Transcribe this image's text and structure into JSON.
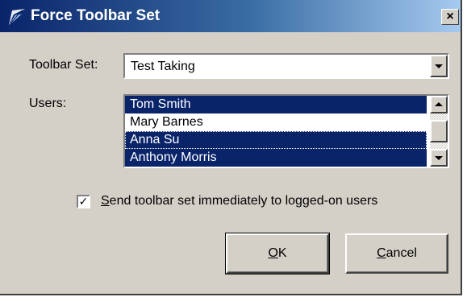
{
  "window": {
    "title": "Force Toolbar Set",
    "close_glyph": "×",
    "icon": "toolbar-app-icon"
  },
  "toolbar_set": {
    "label": "Toolbar Set:",
    "value": "Test Taking"
  },
  "users": {
    "label": "Users:",
    "items": [
      {
        "name": "Tom Smith",
        "selected": true
      },
      {
        "name": "Mary Barnes",
        "selected": false
      },
      {
        "name": "Anna Su",
        "selected": true,
        "focused": true
      },
      {
        "name": "Anthony Morris",
        "selected": true
      }
    ]
  },
  "send_option": {
    "checked": true,
    "check_mark": "✓",
    "mnemonic": "S",
    "label_rest": "end toolbar set immediately to logged-on users"
  },
  "buttons": {
    "ok": {
      "mnemonic": "O",
      "rest": "K"
    },
    "cancel": {
      "mnemonic": "C",
      "rest": "ancel"
    }
  },
  "colors": {
    "dialog_bg": "#d4d0c8",
    "selection_bg": "#0a246a",
    "title_gradient_start": "#0a246a",
    "title_gradient_end": "#a6caf0"
  }
}
